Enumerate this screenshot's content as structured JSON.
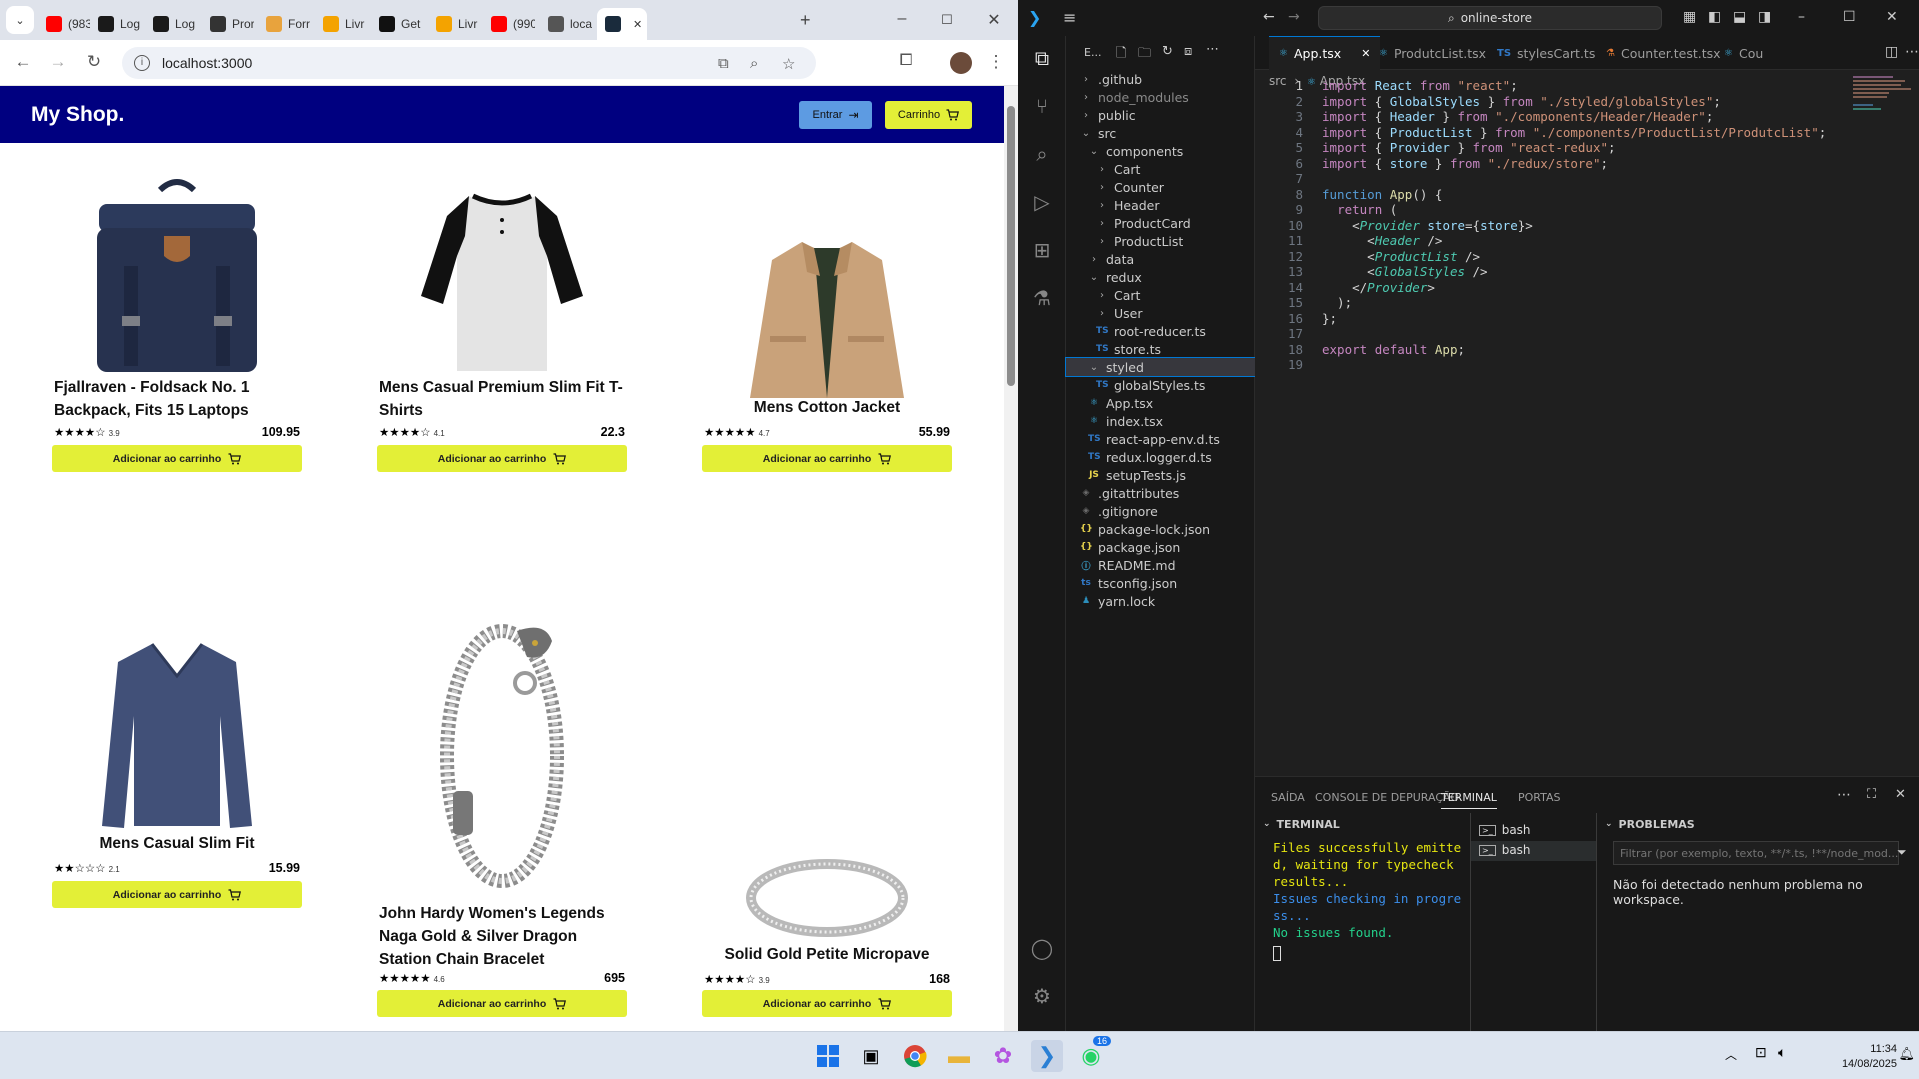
{
  "chrome": {
    "tabs": [
      {
        "label": "(983",
        "icon": "youtube-icon",
        "color": "#ff0000"
      },
      {
        "label": "Log",
        "icon": "app-a-icon",
        "color": "#1a1a1a"
      },
      {
        "label": "Log",
        "icon": "app-a-icon",
        "color": "#1a1a1a"
      },
      {
        "label": "Pror",
        "icon": "openai-icon",
        "color": "#333333"
      },
      {
        "label": "Forr",
        "icon": "forms-icon",
        "color": "#e8a33d"
      },
      {
        "label": "Livr",
        "icon": "udemy-icon",
        "color": "#f4a300"
      },
      {
        "label": "Get",
        "icon": "github-icon",
        "color": "#111111"
      },
      {
        "label": "Livr",
        "icon": "udemy-icon",
        "color": "#f4a300"
      },
      {
        "label": "(990",
        "icon": "youtube-icon",
        "color": "#ff0000"
      },
      {
        "label": "loca",
        "icon": "page-icon",
        "color": "#555555"
      },
      {
        "label": "",
        "icon": "react-icon",
        "color": "#1a2b3c"
      }
    ],
    "url": "localhost:3000"
  },
  "shop": {
    "logo": "My Shop.",
    "login_label": "Entrar",
    "cart_label": "Carrinho",
    "add_label": "Adicionar ao carrinho",
    "products": [
      {
        "title": "Fjallraven - Foldsack No. 1 Backpack, Fits 15 Laptops",
        "stars": "★★★★☆",
        "rating": "3.9",
        "price": "109.95"
      },
      {
        "title": "Mens Casual Premium Slim Fit T-Shirts",
        "stars": "★★★★☆",
        "rating": "4.1",
        "price": "22.3"
      },
      {
        "title": "Mens Cotton Jacket",
        "stars": "★★★★★",
        "rating": "4.7",
        "price": "55.99"
      },
      {
        "title": "Mens Casual Slim Fit",
        "stars": "★★☆☆☆",
        "rating": "2.1",
        "price": "15.99"
      },
      {
        "title": "John Hardy Women's Legends Naga Gold & Silver Dragon Station Chain Bracelet",
        "stars": "★★★★★",
        "rating": "4.6",
        "price": "695"
      },
      {
        "title": "Solid Gold Petite Micropave",
        "stars": "★★★★☆",
        "rating": "3.9",
        "price": "168"
      }
    ]
  },
  "vscode": {
    "search": "online-store",
    "explorer_label": "E...",
    "tree": [
      {
        "label": ".github",
        "type": "folder",
        "depth": 0,
        "open": false
      },
      {
        "label": "node_modules",
        "type": "folder",
        "depth": 0,
        "open": false,
        "dim": true
      },
      {
        "label": "public",
        "type": "folder",
        "depth": 0,
        "open": false
      },
      {
        "label": "src",
        "type": "folder",
        "depth": 0,
        "open": true
      },
      {
        "label": "components",
        "type": "folder",
        "depth": 1,
        "open": true
      },
      {
        "label": "Cart",
        "type": "folder",
        "depth": 2,
        "open": false
      },
      {
        "label": "Counter",
        "type": "folder",
        "depth": 2,
        "open": false
      },
      {
        "label": "Header",
        "type": "folder",
        "depth": 2,
        "open": false
      },
      {
        "label": "ProductCard",
        "type": "folder",
        "depth": 2,
        "open": false
      },
      {
        "label": "ProductList",
        "type": "folder",
        "depth": 2,
        "open": false
      },
      {
        "label": "data",
        "type": "folder",
        "depth": 1,
        "open": false
      },
      {
        "label": "redux",
        "type": "folder",
        "depth": 1,
        "open": true
      },
      {
        "label": "Cart",
        "type": "folder",
        "depth": 2,
        "open": false
      },
      {
        "label": "User",
        "type": "folder",
        "depth": 2,
        "open": false
      },
      {
        "label": "root-reducer.ts",
        "type": "ts",
        "depth": 2
      },
      {
        "label": "store.ts",
        "type": "ts",
        "depth": 2
      },
      {
        "label": "styled",
        "type": "folder",
        "depth": 1,
        "open": true,
        "selected": true
      },
      {
        "label": "globalStyles.ts",
        "type": "ts",
        "depth": 2
      },
      {
        "label": "App.tsx",
        "type": "react",
        "depth": 1
      },
      {
        "label": "index.tsx",
        "type": "react",
        "depth": 1
      },
      {
        "label": "react-app-env.d.ts",
        "type": "ts",
        "depth": 1
      },
      {
        "label": "redux.logger.d.ts",
        "type": "ts",
        "depth": 1
      },
      {
        "label": "setupTests.js",
        "type": "js",
        "depth": 1
      },
      {
        "label": ".gitattributes",
        "type": "git",
        "depth": 0
      },
      {
        "label": ".gitignore",
        "type": "git",
        "depth": 0
      },
      {
        "label": "package-lock.json",
        "type": "json",
        "depth": 0
      },
      {
        "label": "package.json",
        "type": "json",
        "depth": 0
      },
      {
        "label": "README.md",
        "type": "info",
        "depth": 0
      },
      {
        "label": "tsconfig.json",
        "type": "tsconfig",
        "depth": 0
      },
      {
        "label": "yarn.lock",
        "type": "yarn",
        "depth": 0
      }
    ],
    "editor_tabs": [
      {
        "label": "App.tsx",
        "active": true,
        "kind": "react"
      },
      {
        "label": "ProdutcList.tsx",
        "active": false,
        "kind": "react"
      },
      {
        "label": "stylesCart.ts",
        "active": false,
        "kind": "ts"
      },
      {
        "label": "Counter.test.tsx",
        "active": false,
        "kind": "test"
      },
      {
        "label": "Cou",
        "active": false,
        "kind": "react"
      }
    ],
    "breadcrumb": [
      "src",
      "App.tsx"
    ],
    "code_lines": [
      "import React from \"react\";",
      "import { GlobalStyles } from \"./styled/globalStyles\";",
      "import { Header } from \"./components/Header/Header\";",
      "import { ProductList } from \"./components/ProductList/ProdutcList\";",
      "import { Provider } from \"react-redux\";",
      "import { store } from \"./redux/store\";",
      "",
      "function App() {",
      "  return (",
      "    <Provider store={store}>",
      "      <Header />",
      "      <ProductList />",
      "      <GlobalStyles />",
      "    </Provider>",
      "  );",
      "};",
      "",
      "export default App;",
      ""
    ],
    "panel_tabs": [
      "SAÍDA",
      "CONSOLE DE DEPURAÇÃO",
      "TERMINAL",
      "PORTAS"
    ],
    "terminal_header": "TERMINAL",
    "terminal_lines": [
      {
        "text": "Files successfully emitte",
        "color": "#e5e510"
      },
      {
        "text": "d, waiting for typecheck",
        "color": "#e5e510"
      },
      {
        "text": "results...",
        "color": "#e5e510"
      },
      {
        "text": "Issues checking in progre",
        "color": "#3b8eea"
      },
      {
        "text": "ss...",
        "color": "#3b8eea"
      },
      {
        "text": "No issues found.",
        "color": "#23d18b"
      }
    ],
    "terminals": [
      "bash",
      "bash"
    ],
    "problems_header": "PROBLEMAS",
    "problems_filter_placeholder": "Filtrar (por exemplo, texto, **/*.ts, !**/node_mod...",
    "problems_message": "Não foi detectado nenhum problema no workspace."
  },
  "taskbar": {
    "time": "11:34",
    "date": "14/08/2025",
    "whatsapp_badge": "16"
  }
}
